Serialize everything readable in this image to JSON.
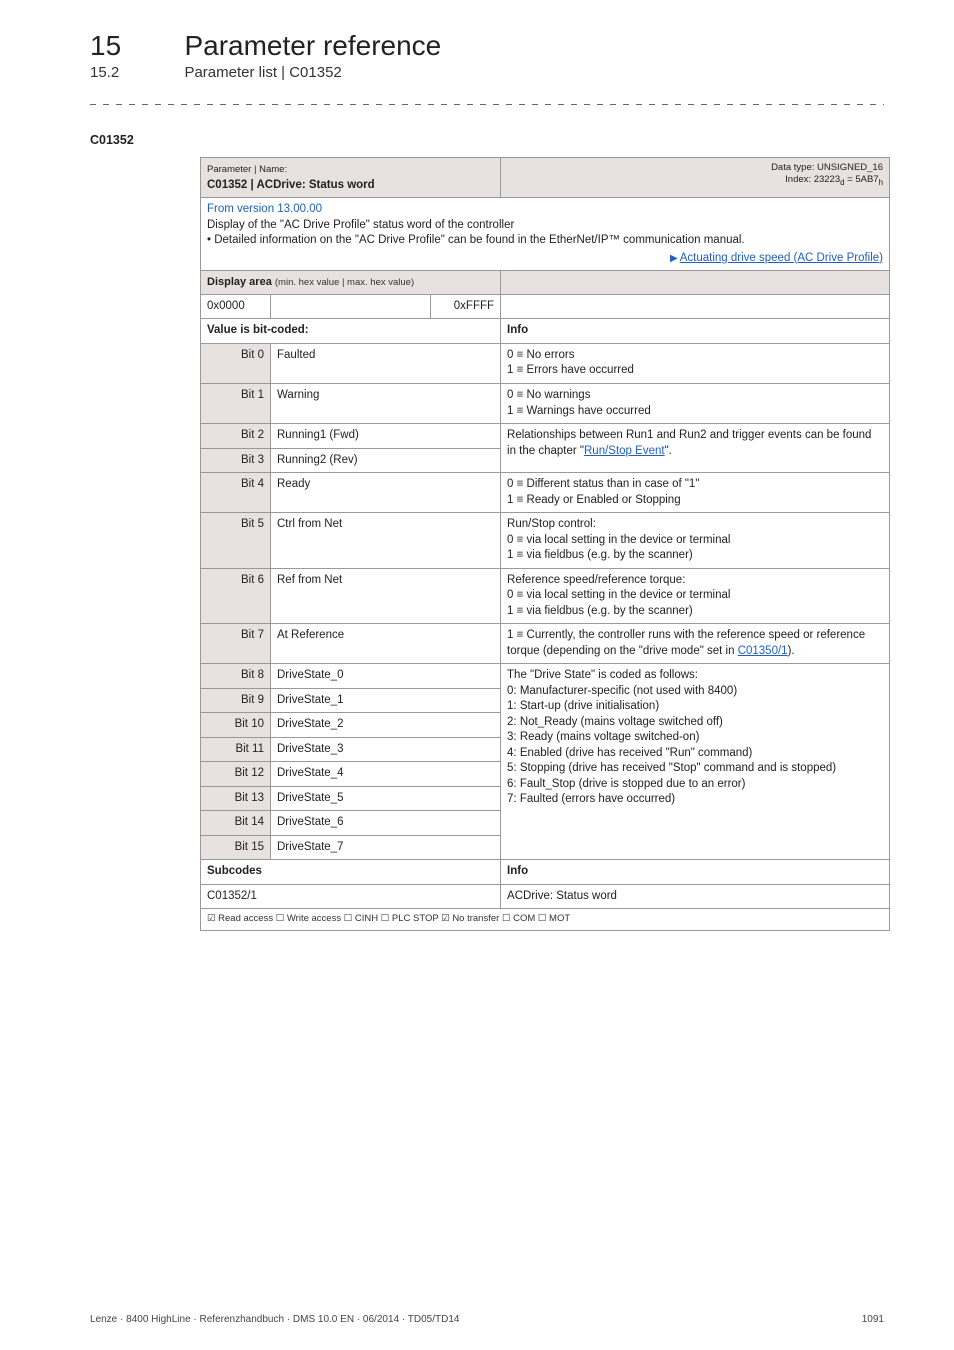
{
  "header": {
    "chapnum": "15",
    "chaptitle": "Parameter reference",
    "secnum": "15.2",
    "sectitle": "Parameter list | C01352"
  },
  "param_id": "C01352",
  "table": {
    "top": {
      "pn_label": "Parameter | Name:",
      "pname": "C01352 | ACDrive: Status word",
      "datatype": "Data type: UNSIGNED_16",
      "index": "Index: 23223d = 5AB7h",
      "index_prefix": "Index: 23223",
      "index_d": "d",
      "index_mid": " = 5AB7",
      "index_h": "h"
    },
    "desc": {
      "fromver": "From version 13.00.00",
      "line1": "Display of the \"AC Drive Profile\" status word of the controller",
      "bullet": "• Detailed information on the \"AC Drive Profile\" can be found in the EtherNet/IP™ communication manual.",
      "arrowlink": "Actuating drive speed (AC Drive Profile)"
    },
    "disp_label": "Display area",
    "disp_sub": "(min. hex value | max. hex value)",
    "disp_min": "0x0000",
    "disp_max": "0xFFFF",
    "valhdr_left": "Value is bit-coded:",
    "valhdr_right": "Info",
    "bits": [
      {
        "bit": "Bit 0",
        "name": "Faulted",
        "info": "0 ≡ No errors\n1 ≡ Errors have occurred"
      },
      {
        "bit": "Bit 1",
        "name": "Warning",
        "info": "0 ≡ No warnings\n1 ≡ Warnings have occurred"
      },
      {
        "bit": "Bit 2",
        "name": "Running1 (Fwd)",
        "info_combined_top": true,
        "info": "Relationships between Run1 and Run2 and trigger events can be found in the chapter \"",
        "info_link": "Run/Stop Event",
        "info_tail": "\"."
      },
      {
        "bit": "Bit 3",
        "name": "Running2 (Rev)"
      },
      {
        "bit": "Bit 4",
        "name": "Ready",
        "info": "0 ≡ Different status than in case of \"1\"\n1 ≡ Ready or Enabled or Stopping"
      },
      {
        "bit": "Bit 5",
        "name": "Ctrl from Net",
        "info": "Run/Stop control:\n0 ≡ via local setting in the device or terminal\n1 ≡ via fieldbus (e.g. by the scanner)"
      },
      {
        "bit": "Bit 6",
        "name": "Ref from Net",
        "info": "Reference speed/reference torque:\n0 ≡ via local setting in the device or terminal\n1 ≡ via fieldbus (e.g. by the scanner)"
      },
      {
        "bit": "Bit 7",
        "name": "At Reference",
        "info_pre": "1 ≡ Currently, the controller runs with the reference speed or reference torque (depending on the \"drive mode\" set in ",
        "info_link": "C01350/1",
        "info_post": ")."
      },
      {
        "bit": "Bit 8",
        "name": "DriveState_0",
        "ds_start": true,
        "ds_lines": [
          "The \"Drive State\" is coded as follows:",
          "0: Manufacturer-specific (not used with 8400)",
          "1: Start-up (drive initialisation)",
          "2: Not_Ready (mains voltage switched off)",
          "3: Ready (mains voltage switched-on)",
          "4: Enabled (drive has received \"Run\" command)",
          "5: Stopping (drive has received \"Stop\" command and is stopped)",
          "6: Fault_Stop (drive is stopped due to an error)",
          "7: Faulted (errors have occurred)"
        ]
      },
      {
        "bit": "Bit 9",
        "name": "DriveState_1"
      },
      {
        "bit": "Bit 10",
        "name": "DriveState_2"
      },
      {
        "bit": "Bit 11",
        "name": "DriveState_3"
      },
      {
        "bit": "Bit 12",
        "name": "DriveState_4"
      },
      {
        "bit": "Bit 13",
        "name": "DriveState_5"
      },
      {
        "bit": "Bit 14",
        "name": "DriveState_6"
      },
      {
        "bit": "Bit 15",
        "name": "DriveState_7"
      }
    ],
    "sub_left": "Subcodes",
    "sub_right": "Info",
    "subrow_left": "C01352/1",
    "subrow_right": "ACDrive: Status word",
    "access": "☑ Read access   ☐ Write access   ☐ CINH   ☐ PLC STOP   ☑ No transfer   ☐ COM   ☐ MOT"
  },
  "footer": {
    "left": "Lenze · 8400 HighLine · Referenzhandbuch · DMS 10.0 EN · 06/2014 · TD05/TD14",
    "right": "1091"
  }
}
